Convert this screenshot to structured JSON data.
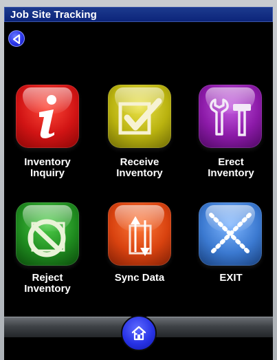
{
  "window": {
    "title": "Job Site Tracking"
  },
  "nav": {
    "back_icon": "back-arrow-icon",
    "home_icon": "home-icon"
  },
  "tiles": [
    {
      "label": "Inventory\nInquiry",
      "icon": "info-icon",
      "color": "#d11414"
    },
    {
      "label": "Receive\nInventory",
      "icon": "checkmark-icon",
      "color": "#b9b20f"
    },
    {
      "label": "Erect\nInventory",
      "icon": "tools-icon",
      "color": "#8c1aa8"
    },
    {
      "label": "Reject\nInventory",
      "icon": "no-entry-icon",
      "color": "#1f8b1f"
    },
    {
      "label": "Sync Data",
      "icon": "sync-arrows-icon",
      "color": "#d8420f"
    },
    {
      "label": "EXIT",
      "icon": "exit-x-icon",
      "color": "#3b79d0"
    }
  ]
}
